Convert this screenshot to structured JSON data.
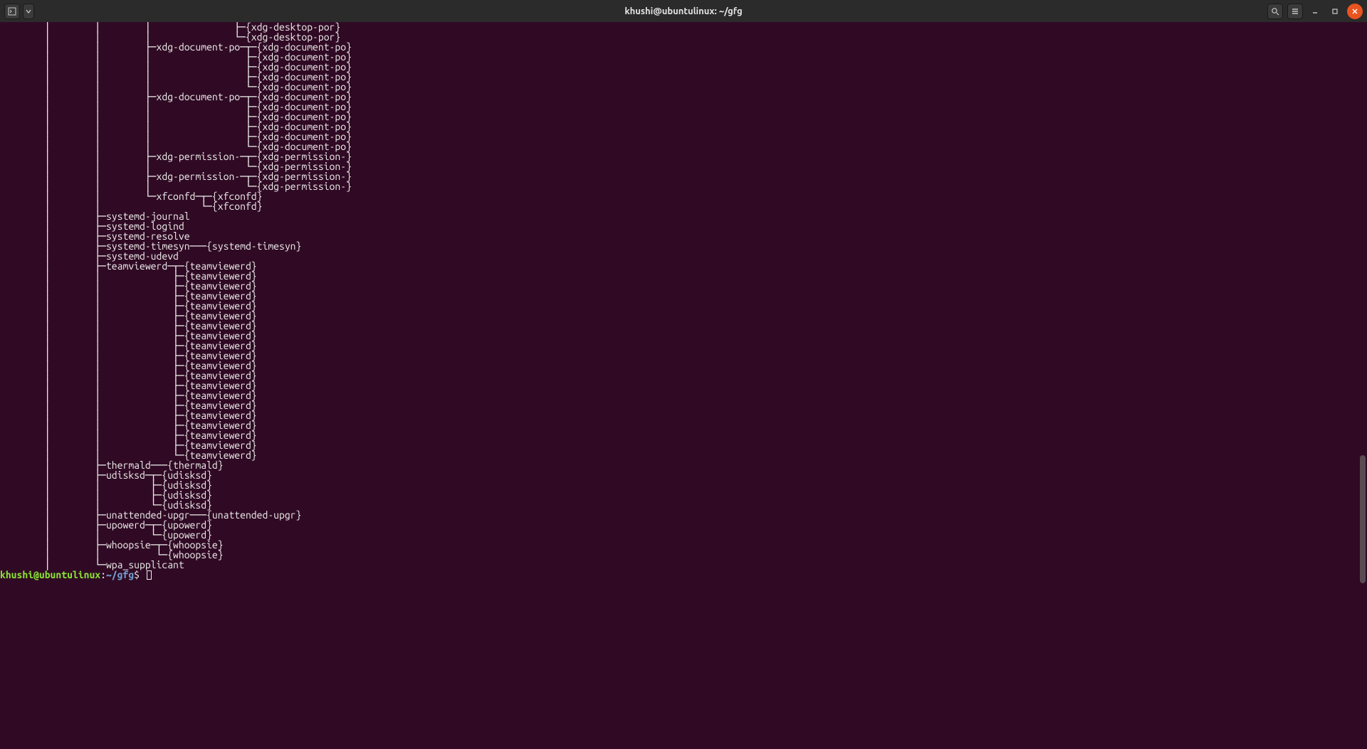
{
  "titlebar": {
    "title": "khushi@ubuntulinux: ~/gfg"
  },
  "tree_lines": [
    "        │        │        │               ├─{xdg-desktop-por}",
    "        │        │        │               └─{xdg-desktop-por}",
    "        │        │        ├─xdg-document-po─┬─{xdg-document-po}",
    "        │        │        │                 ├─{xdg-document-po}",
    "        │        │        │                 ├─{xdg-document-po}",
    "        │        │        │                 ├─{xdg-document-po}",
    "        │        │        │                 └─{xdg-document-po}",
    "        │        │        ├─xdg-document-po─┬─{xdg-document-po}",
    "        │        │        │                 ├─{xdg-document-po}",
    "        │        │        │                 ├─{xdg-document-po}",
    "        │        │        │                 ├─{xdg-document-po}",
    "        │        │        │                 ├─{xdg-document-po}",
    "        │        │        │                 └─{xdg-document-po}",
    "        │        │        ├─xdg-permission-─┬─{xdg-permission-}",
    "        │        │        │                 └─{xdg-permission-}",
    "        │        │        ├─xdg-permission-─┬─{xdg-permission-}",
    "        │        │        │                 └─{xdg-permission-}",
    "        │        │        └─xfconfd─┬─{xfconfd}",
    "        │        │                  └─{xfconfd}",
    "        │        ├─systemd-journal",
    "        │        ├─systemd-logind",
    "        │        ├─systemd-resolve",
    "        │        ├─systemd-timesyn───{systemd-timesyn}",
    "        │        ├─systemd-udevd",
    "        │        ├─teamviewerd─┬─{teamviewerd}",
    "        │        │             ├─{teamviewerd}",
    "        │        │             ├─{teamviewerd}",
    "        │        │             ├─{teamviewerd}",
    "        │        │             ├─{teamviewerd}",
    "        │        │             ├─{teamviewerd}",
    "        │        │             ├─{teamviewerd}",
    "        │        │             ├─{teamviewerd}",
    "        │        │             ├─{teamviewerd}",
    "        │        │             ├─{teamviewerd}",
    "        │        │             ├─{teamviewerd}",
    "        │        │             ├─{teamviewerd}",
    "        │        │             ├─{teamviewerd}",
    "        │        │             ├─{teamviewerd}",
    "        │        │             ├─{teamviewerd}",
    "        │        │             ├─{teamviewerd}",
    "        │        │             ├─{teamviewerd}",
    "        │        │             ├─{teamviewerd}",
    "        │        │             ├─{teamviewerd}",
    "        │        │             └─{teamviewerd}",
    "        │        ├─thermald───{thermald}",
    "        │        ├─udisksd─┬─{udisksd}",
    "        │        │         ├─{udisksd}",
    "        │        │         ├─{udisksd}",
    "        │        │         └─{udisksd}",
    "        │        ├─unattended-upgr───{unattended-upgr}",
    "        │        ├─upowerd─┬─{upowerd}",
    "        │        │         └─{upowerd}",
    "        │        ├─whoopsie─┬─{whoopsie}",
    "        │        │          └─{whoopsie}",
    "        │        └─wpa_supplicant"
  ],
  "prompt": {
    "user_host": "khushi@ubuntulinux",
    "sep": ":",
    "path": "~/gfg",
    "symbol": "$"
  }
}
